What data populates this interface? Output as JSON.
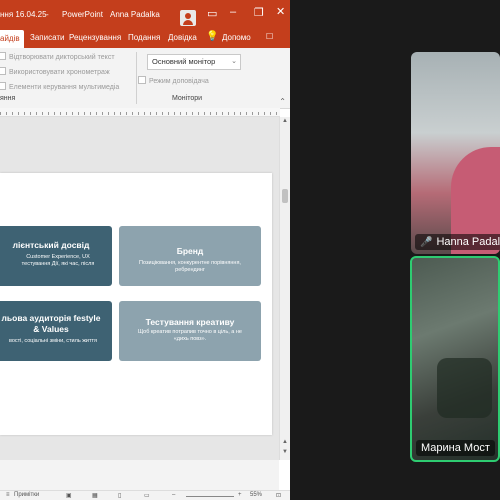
{
  "window": {
    "title": "ння 16.04.25",
    "app_name": "PowerPoint",
    "user": "Anna Padalka",
    "colors": {
      "accent": "#c43e1c"
    }
  },
  "tabs": [
    {
      "label": "айдів",
      "active": true
    },
    {
      "label": "Записати"
    },
    {
      "label": "Рецензування"
    },
    {
      "label": "Подання"
    },
    {
      "label": "Довідка"
    },
    {
      "label": "Допомо"
    }
  ],
  "ribbon": {
    "options": [
      "Відтворювати дикторський текст",
      "Використовувати хронометраж",
      "Елементи керування мультимедіа"
    ],
    "monitor": {
      "value": "Основний монітор",
      "presenter_view": "Режим доповідача",
      "group_label": "Монітори"
    },
    "left_group_label": "яння"
  },
  "slide": {
    "cards": [
      {
        "title": "лієнтський досвід",
        "text": "Customer Experience, UX тестування Дії, які час, після",
        "style": "dark"
      },
      {
        "title": "Бренд",
        "text": "Позиціювання, конкурентне порівняння, ребрендинг",
        "style": "light"
      },
      {
        "title": "льова аудиторія festyle & Values",
        "text": "вості, соціальні зміни, стиль життя",
        "style": "dark"
      },
      {
        "title": "Тестування креативу",
        "text": "Щоб креатив потрапив точно в ціль, а не «дихь повз».",
        "style": "light"
      }
    ]
  },
  "statusbar": {
    "notes": "Примітки",
    "zoom": "55%"
  },
  "participants": [
    {
      "name": "Hanna Padal",
      "muted": true
    },
    {
      "name": "Марина Мост",
      "active_speaker": true
    }
  ]
}
